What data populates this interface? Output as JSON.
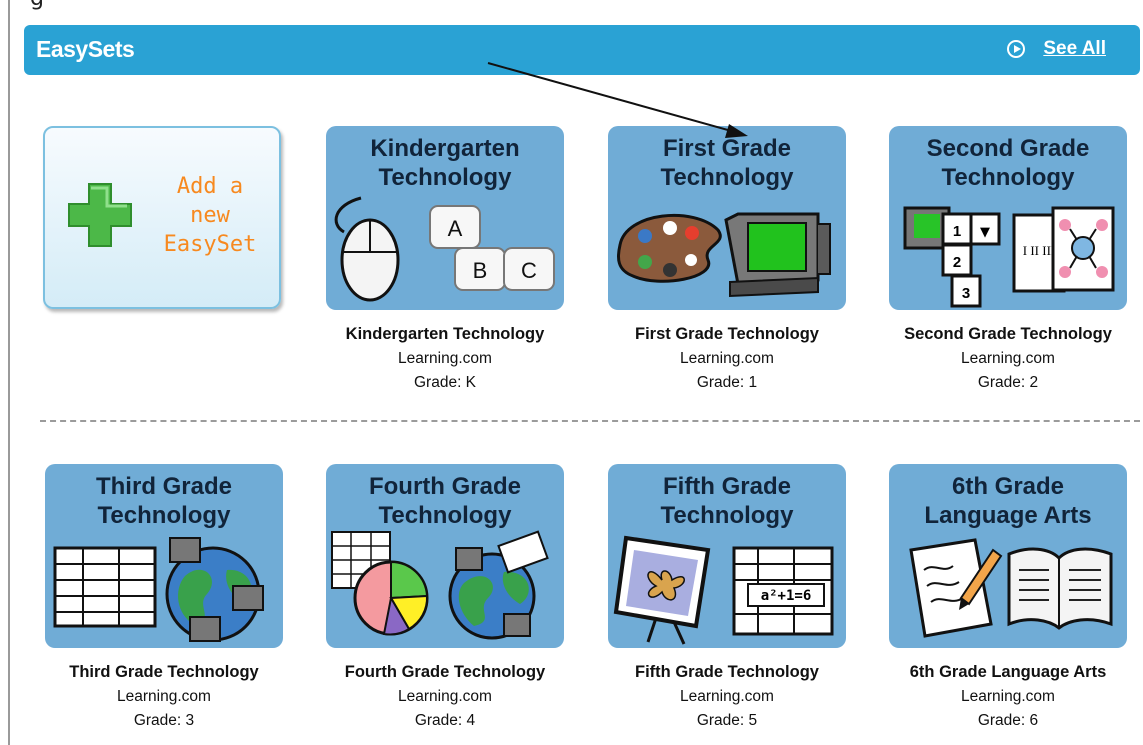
{
  "top_fragment": "g",
  "header": {
    "title": "EasySets",
    "see_all": "See All"
  },
  "add_tile": {
    "lines": [
      "Add a",
      "new",
      "EasySet"
    ]
  },
  "cards": [
    {
      "tile_lines": [
        "Kindergarten",
        "Technology"
      ],
      "name": "Kindergarten Technology",
      "source": "Learning.com",
      "grade": "Grade: K",
      "art": "mouse-keys"
    },
    {
      "tile_lines": [
        "First Grade",
        "Technology"
      ],
      "name": "First Grade Technology",
      "source": "Learning.com",
      "grade": "Grade: 1",
      "art": "palette-monitor"
    },
    {
      "tile_lines": [
        "Second Grade",
        "Technology"
      ],
      "name": "Second Grade Technology",
      "source": "Learning.com",
      "grade": "Grade: 2",
      "art": "cards-diagram"
    },
    {
      "tile_lines": [
        "Third Grade",
        "Technology"
      ],
      "name": "Third Grade Technology",
      "source": "Learning.com",
      "grade": "Grade: 3",
      "art": "table-globe"
    },
    {
      "tile_lines": [
        "Fourth Grade",
        "Technology"
      ],
      "name": "Fourth Grade Technology",
      "source": "Learning.com",
      "grade": "Grade: 4",
      "art": "pie-globe"
    },
    {
      "tile_lines": [
        "Fifth Grade",
        "Technology"
      ],
      "name": "Fifth Grade Technology",
      "source": "Learning.com",
      "grade": "Grade: 5",
      "art": "easel-spreadsheet"
    },
    {
      "tile_lines": [
        "6th Grade",
        "Language Arts"
      ],
      "name": "6th Grade Language Arts",
      "source": "Learning.com",
      "grade": "Grade: 6",
      "art": "paper-book"
    }
  ],
  "art_labels": {
    "key_a": "A",
    "key_b": "B",
    "key_c": "C",
    "card_1": "1",
    "card_2": "2",
    "card_3": "3",
    "card_tri": "▼",
    "roman": "I II III",
    "formula": "a²+1=6"
  },
  "colors": {
    "header": "#2aa2d4",
    "tile": "#70acd6",
    "add_text": "#f7891f",
    "plus": "#4cb848"
  }
}
